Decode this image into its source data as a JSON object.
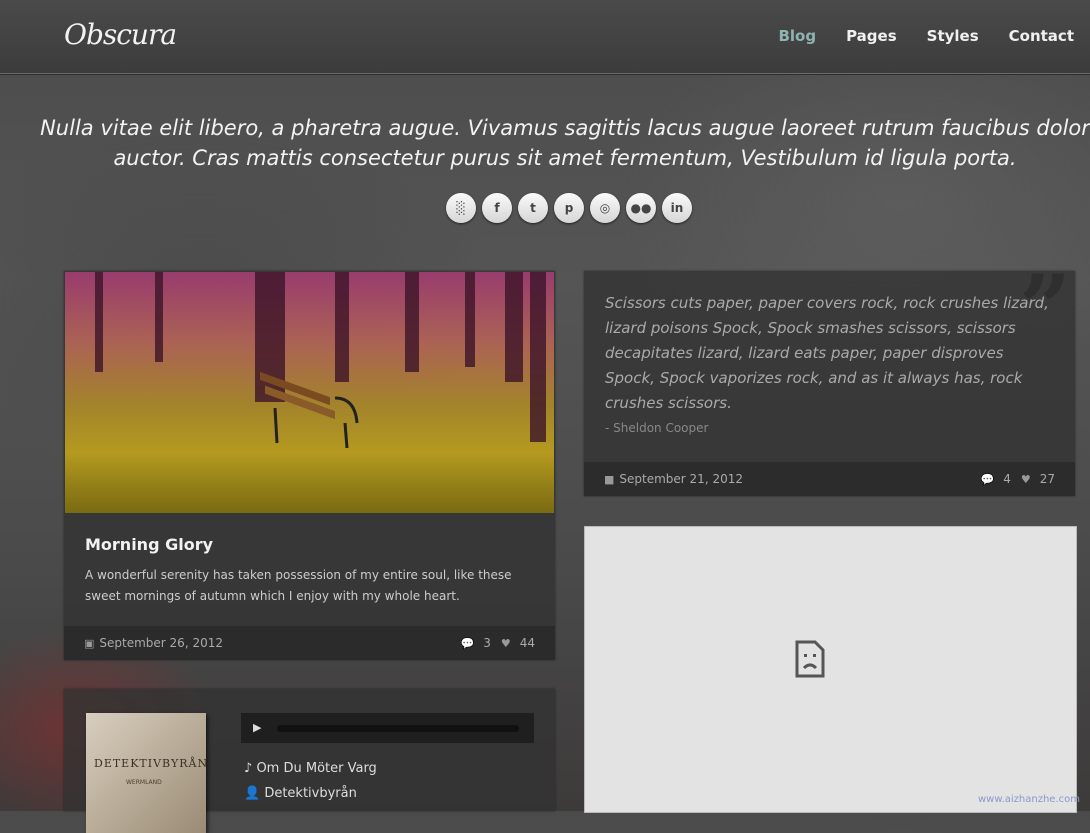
{
  "header": {
    "logo": "Obscura",
    "nav": [
      {
        "label": "Blog",
        "active": true
      },
      {
        "label": "Pages",
        "active": false
      },
      {
        "label": "Styles",
        "active": false
      },
      {
        "label": "Contact",
        "active": false
      }
    ]
  },
  "hero": {
    "text": "Nulla vitae elit libero, a pharetra augue. Vivamus sagittis lacus augue laoreet rutrum faucibus dolor auctor. Cras mattis consectetur purus sit amet fermentum, Vestibulum id ligula porta."
  },
  "social": [
    {
      "icon": "rss-icon",
      "glyph": "░"
    },
    {
      "icon": "facebook-icon",
      "glyph": "f"
    },
    {
      "icon": "twitter-icon",
      "glyph": "t"
    },
    {
      "icon": "pinterest-icon",
      "glyph": "p"
    },
    {
      "icon": "dribbble-icon",
      "glyph": "◎"
    },
    {
      "icon": "flickr-icon",
      "glyph": "●●"
    },
    {
      "icon": "linkedin-icon",
      "glyph": "in"
    }
  ],
  "post1": {
    "title": "Morning Glory",
    "excerpt": "A wonderful serenity has taken possession of my entire soul, like these sweet mornings of autumn which I enjoy with my whole heart.",
    "date": "September 26, 2012",
    "comments": "3",
    "likes": "44"
  },
  "quote": {
    "text": "Scissors cuts paper, paper covers rock, rock crushes lizard, lizard poisons Spock, Spock smashes scissors, scissors decapitates lizard, lizard eats paper, paper disproves Spock, Spock vaporizes rock, and as it always has, rock crushes scissors.",
    "author": "- Sheldon Cooper",
    "mark": "”",
    "date": "September 21, 2012",
    "comments": "4",
    "likes": "27"
  },
  "audio": {
    "album_title": "DETEKTIVBYRÅN",
    "album_sub": "WERMLAND",
    "song": "Om Du Möter Varg",
    "artist": "Detektivbyrån"
  },
  "watermark": "www.aizhanzhe.com"
}
